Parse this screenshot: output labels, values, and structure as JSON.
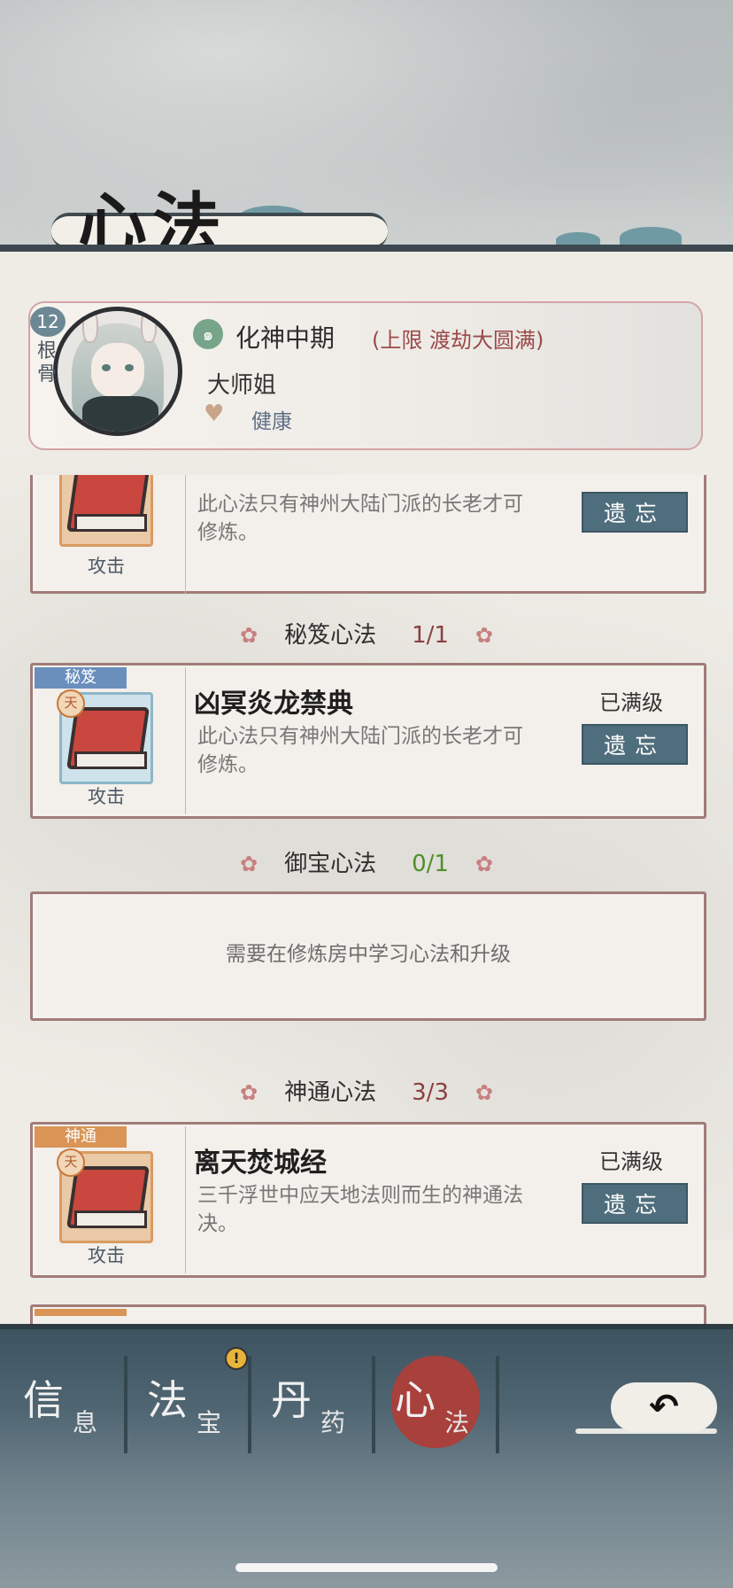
{
  "screen": {
    "title": "心法",
    "back_label": "↶"
  },
  "character": {
    "root_value": "12",
    "root_label": "根骨",
    "realm": "化神中期",
    "limit": "(上限 渡劫大圆满)",
    "name": "大师姐",
    "status": "健康"
  },
  "partial_card": {
    "type": "攻击",
    "desc": "此心法只有神州大陆门派的长老才可修炼。",
    "forget_label": "遗忘"
  },
  "sections": [
    {
      "title": "秘笈心法",
      "count": "1/1",
      "card": {
        "tag": "秘笈",
        "name": "凶冥炎龙禁典",
        "status": "已满级",
        "desc": "此心法只有神州大陆门派的长老才可修炼。",
        "type": "攻击",
        "forget_label": "遗忘",
        "tier": "天"
      }
    },
    {
      "title": "御宝心法",
      "count": "0/1",
      "empty_text": "需要在修炼房中学习心法和升级"
    },
    {
      "title": "神通心法",
      "count": "3/3",
      "card": {
        "tag": "神通",
        "name": "离天焚城经",
        "status": "已满级",
        "desc": "三千浮世中应天地法则而生的神通法决。",
        "type": "攻击",
        "forget_label": "遗忘",
        "tier": "天"
      }
    }
  ],
  "nav": [
    {
      "big": "信",
      "small": "息",
      "active": false
    },
    {
      "big": "法",
      "small": "宝",
      "active": false,
      "alert": "!"
    },
    {
      "big": "丹",
      "small": "药",
      "active": false
    },
    {
      "big": "心",
      "small": "法",
      "active": true
    }
  ],
  "colors": {
    "forget_button": "#4f6e7d",
    "card_border": "#a07c78",
    "count_green": "#4f8f2a",
    "count_red": "#8b4040",
    "seal_red": "#a8403c"
  }
}
